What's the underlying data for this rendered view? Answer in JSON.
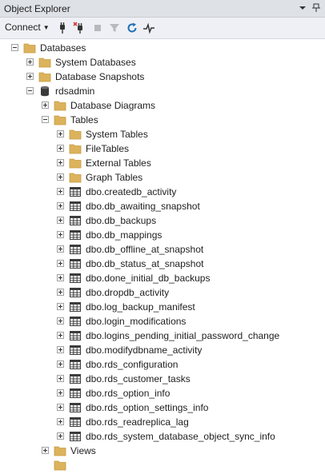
{
  "titlebar": {
    "title": "Object Explorer"
  },
  "toolbar": {
    "connect_label": "Connect"
  },
  "tree": {
    "items": [
      {
        "label": "Databases",
        "depth": 0,
        "expander": "minus",
        "icon": "folder"
      },
      {
        "label": "System Databases",
        "depth": 1,
        "expander": "plus",
        "icon": "folder"
      },
      {
        "label": "Database Snapshots",
        "depth": 1,
        "expander": "plus",
        "icon": "folder"
      },
      {
        "label": "rdsadmin",
        "depth": 1,
        "expander": "minus",
        "icon": "database"
      },
      {
        "label": "Database Diagrams",
        "depth": 2,
        "expander": "plus",
        "icon": "folder"
      },
      {
        "label": "Tables",
        "depth": 2,
        "expander": "minus",
        "icon": "folder"
      },
      {
        "label": "System Tables",
        "depth": 3,
        "expander": "plus",
        "icon": "folder"
      },
      {
        "label": "FileTables",
        "depth": 3,
        "expander": "plus",
        "icon": "folder"
      },
      {
        "label": "External Tables",
        "depth": 3,
        "expander": "plus",
        "icon": "folder"
      },
      {
        "label": "Graph Tables",
        "depth": 3,
        "expander": "plus",
        "icon": "folder"
      },
      {
        "label": "dbo.createdb_activity",
        "depth": 3,
        "expander": "plus",
        "icon": "table"
      },
      {
        "label": "dbo.db_awaiting_snapshot",
        "depth": 3,
        "expander": "plus",
        "icon": "table"
      },
      {
        "label": "dbo.db_backups",
        "depth": 3,
        "expander": "plus",
        "icon": "table"
      },
      {
        "label": "dbo.db_mappings",
        "depth": 3,
        "expander": "plus",
        "icon": "table"
      },
      {
        "label": "dbo.db_offline_at_snapshot",
        "depth": 3,
        "expander": "plus",
        "icon": "table"
      },
      {
        "label": "dbo.db_status_at_snapshot",
        "depth": 3,
        "expander": "plus",
        "icon": "table"
      },
      {
        "label": "dbo.done_initial_db_backups",
        "depth": 3,
        "expander": "plus",
        "icon": "table"
      },
      {
        "label": "dbo.dropdb_activity",
        "depth": 3,
        "expander": "plus",
        "icon": "table"
      },
      {
        "label": "dbo.log_backup_manifest",
        "depth": 3,
        "expander": "plus",
        "icon": "table"
      },
      {
        "label": "dbo.login_modifications",
        "depth": 3,
        "expander": "plus",
        "icon": "table"
      },
      {
        "label": "dbo.logins_pending_initial_password_change",
        "depth": 3,
        "expander": "plus",
        "icon": "table"
      },
      {
        "label": "dbo.modifydbname_activity",
        "depth": 3,
        "expander": "plus",
        "icon": "table"
      },
      {
        "label": "dbo.rds_configuration",
        "depth": 3,
        "expander": "plus",
        "icon": "table"
      },
      {
        "label": "dbo.rds_customer_tasks",
        "depth": 3,
        "expander": "plus",
        "icon": "table"
      },
      {
        "label": "dbo.rds_option_info",
        "depth": 3,
        "expander": "plus",
        "icon": "table"
      },
      {
        "label": "dbo.rds_option_settings_info",
        "depth": 3,
        "expander": "plus",
        "icon": "table"
      },
      {
        "label": "dbo.rds_readreplica_lag",
        "depth": 3,
        "expander": "plus",
        "icon": "table"
      },
      {
        "label": "dbo.rds_system_database_object_sync_info",
        "depth": 3,
        "expander": "plus",
        "icon": "table"
      },
      {
        "label": "Views",
        "depth": 2,
        "expander": "plus",
        "icon": "folder"
      },
      {
        "label": "",
        "depth": 2,
        "expander": "none",
        "icon": "folder"
      }
    ]
  },
  "colors": {
    "titlebar_bg": "#dee1e6",
    "toolbar_bg": "#eef0f5",
    "folder": "#dcb35c",
    "folder_dark": "#c69a3f",
    "table_grid": "#3c3c3c",
    "refresh_icon": "#1f6fb5"
  }
}
